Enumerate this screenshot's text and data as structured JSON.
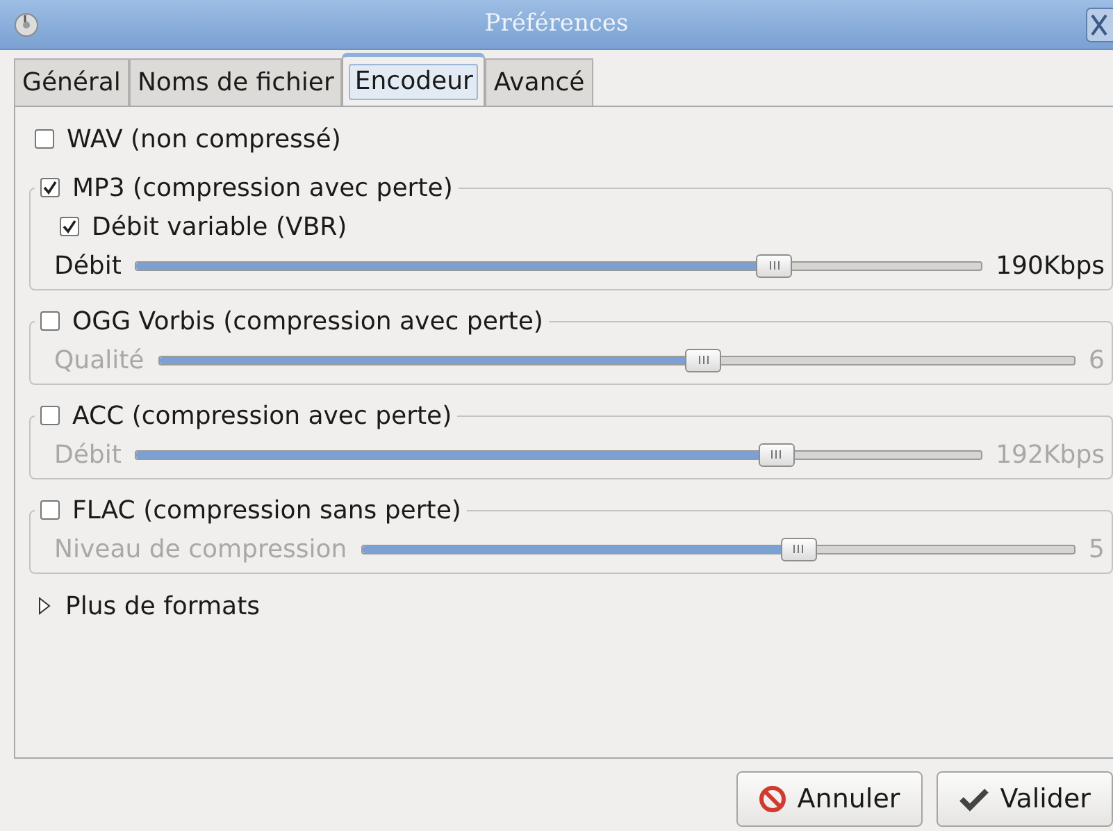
{
  "window": {
    "title": "Préférences"
  },
  "tabs": [
    {
      "label": "Général",
      "selected": false
    },
    {
      "label": "Noms de fichier",
      "selected": false
    },
    {
      "label": "Encodeur",
      "selected": true
    },
    {
      "label": "Avancé",
      "selected": false
    }
  ],
  "formats": [
    {
      "kind": "checkbox",
      "label": "WAV (non compressé)",
      "checked": false
    },
    {
      "kind": "group",
      "label": "MP3 (compression avec perte)",
      "checked": true,
      "option": {
        "label": "Débit variable (VBR)",
        "checked": true
      },
      "slider": {
        "label": "Débit",
        "level": 0.755,
        "reading": "190Kbps"
      }
    },
    {
      "kind": "group",
      "label": "OGG Vorbis (compression avec perte)",
      "checked": false,
      "slider": {
        "label": "Qualité",
        "level": 0.595,
        "reading": "6"
      }
    },
    {
      "kind": "group",
      "label": "ACC  (compression avec perte)",
      "checked": false,
      "slider": {
        "label": "Débit",
        "level": 0.757,
        "reading": "192Kbps"
      }
    },
    {
      "kind": "group",
      "label": "FLAC (compression sans perte)",
      "checked": false,
      "slider": {
        "label": "Niveau de compression",
        "level": 0.613,
        "reading": "5"
      }
    }
  ],
  "more_formats": {
    "label": "Plus de formats",
    "expanded": false
  },
  "buttons": [
    {
      "kind": "cancel",
      "label": "Annuler"
    },
    {
      "kind": "ok",
      "label": "Valider"
    }
  ]
}
